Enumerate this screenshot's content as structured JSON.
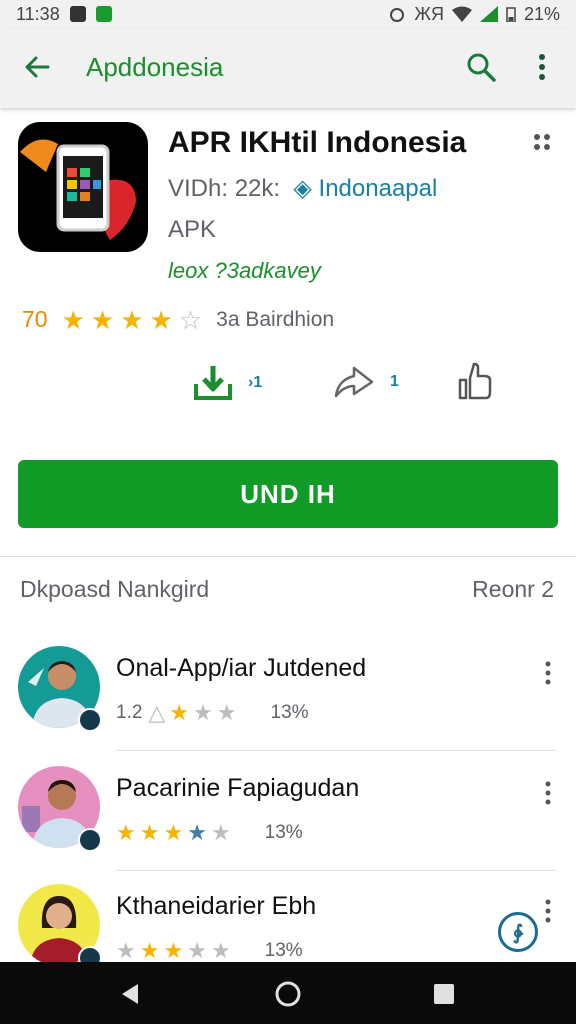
{
  "status_bar": {
    "time": "11:38",
    "network": "ЖЯ",
    "battery": "21%"
  },
  "app_bar": {
    "title": "Apddonesia",
    "back_icon": "arrow-back-icon",
    "search_icon": "search-icon",
    "more_icon": "more-vert-icon"
  },
  "app": {
    "name": "APR IKHtil Indonesia",
    "meta_prefix": "VIDh: 22k:",
    "developer": "Indonaapal",
    "type": "APK",
    "tagline": "leox ?3adkavey",
    "rating_value": "70",
    "rating_stars": 4.5,
    "rating_label": "3a Bairdhion",
    "actions": [
      {
        "icon": "download-icon",
        "count": "›1"
      },
      {
        "icon": "share-icon",
        "count": "1"
      },
      {
        "icon": "thumb-up-icon",
        "count": ""
      }
    ],
    "install_label": "UND IH",
    "accent_color": "#0f9b26"
  },
  "reviews_section": {
    "title": "Dkpoasd Nankgird",
    "link": "Reonr 2",
    "items": [
      {
        "name": "Onal-App/iar Jutdened",
        "prefix": "1.2",
        "stars": [
          "full",
          "empty",
          "empty"
        ],
        "percent": "13%",
        "avatar_bg": "#159b95"
      },
      {
        "name": "Pacarinie Fapiagudan",
        "prefix": "",
        "stars": [
          "full",
          "full",
          "full",
          "blue",
          "empty"
        ],
        "percent": "13%",
        "avatar_bg": "#e58fbf"
      },
      {
        "name": "Kthaneidarier Ebh",
        "prefix": "",
        "stars": [
          "empty",
          "full",
          "full",
          "empty",
          "empty"
        ],
        "percent": "13%",
        "avatar_bg": "#f2e84a"
      }
    ]
  },
  "fab_icon": "info-icon",
  "nav_bar": {
    "back_icon": "nav-back-icon",
    "home_icon": "nav-home-icon",
    "recents_icon": "nav-recents-icon"
  }
}
